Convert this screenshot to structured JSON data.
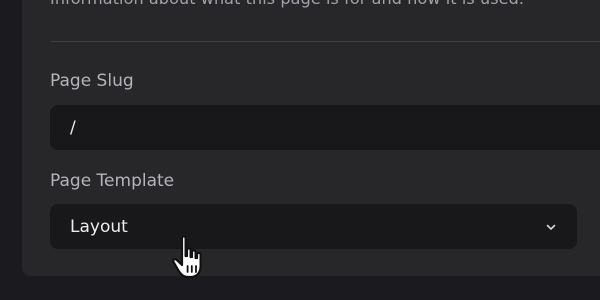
{
  "intro": {
    "text": "Information about what this page is for and how it is used."
  },
  "slug": {
    "label": "Page Slug",
    "value": "/"
  },
  "template": {
    "label": "Page Template",
    "selected": "Layout",
    "icon": "chevron-down-icon"
  },
  "cursor": {
    "icon": "hand-pointer-cursor-icon"
  },
  "colors": {
    "page_bg": "#1b1b1f",
    "panel_bg": "#27272a",
    "field_bg": "#18181b",
    "text_muted": "#a1a1aa",
    "text_primary": "#ececef"
  }
}
